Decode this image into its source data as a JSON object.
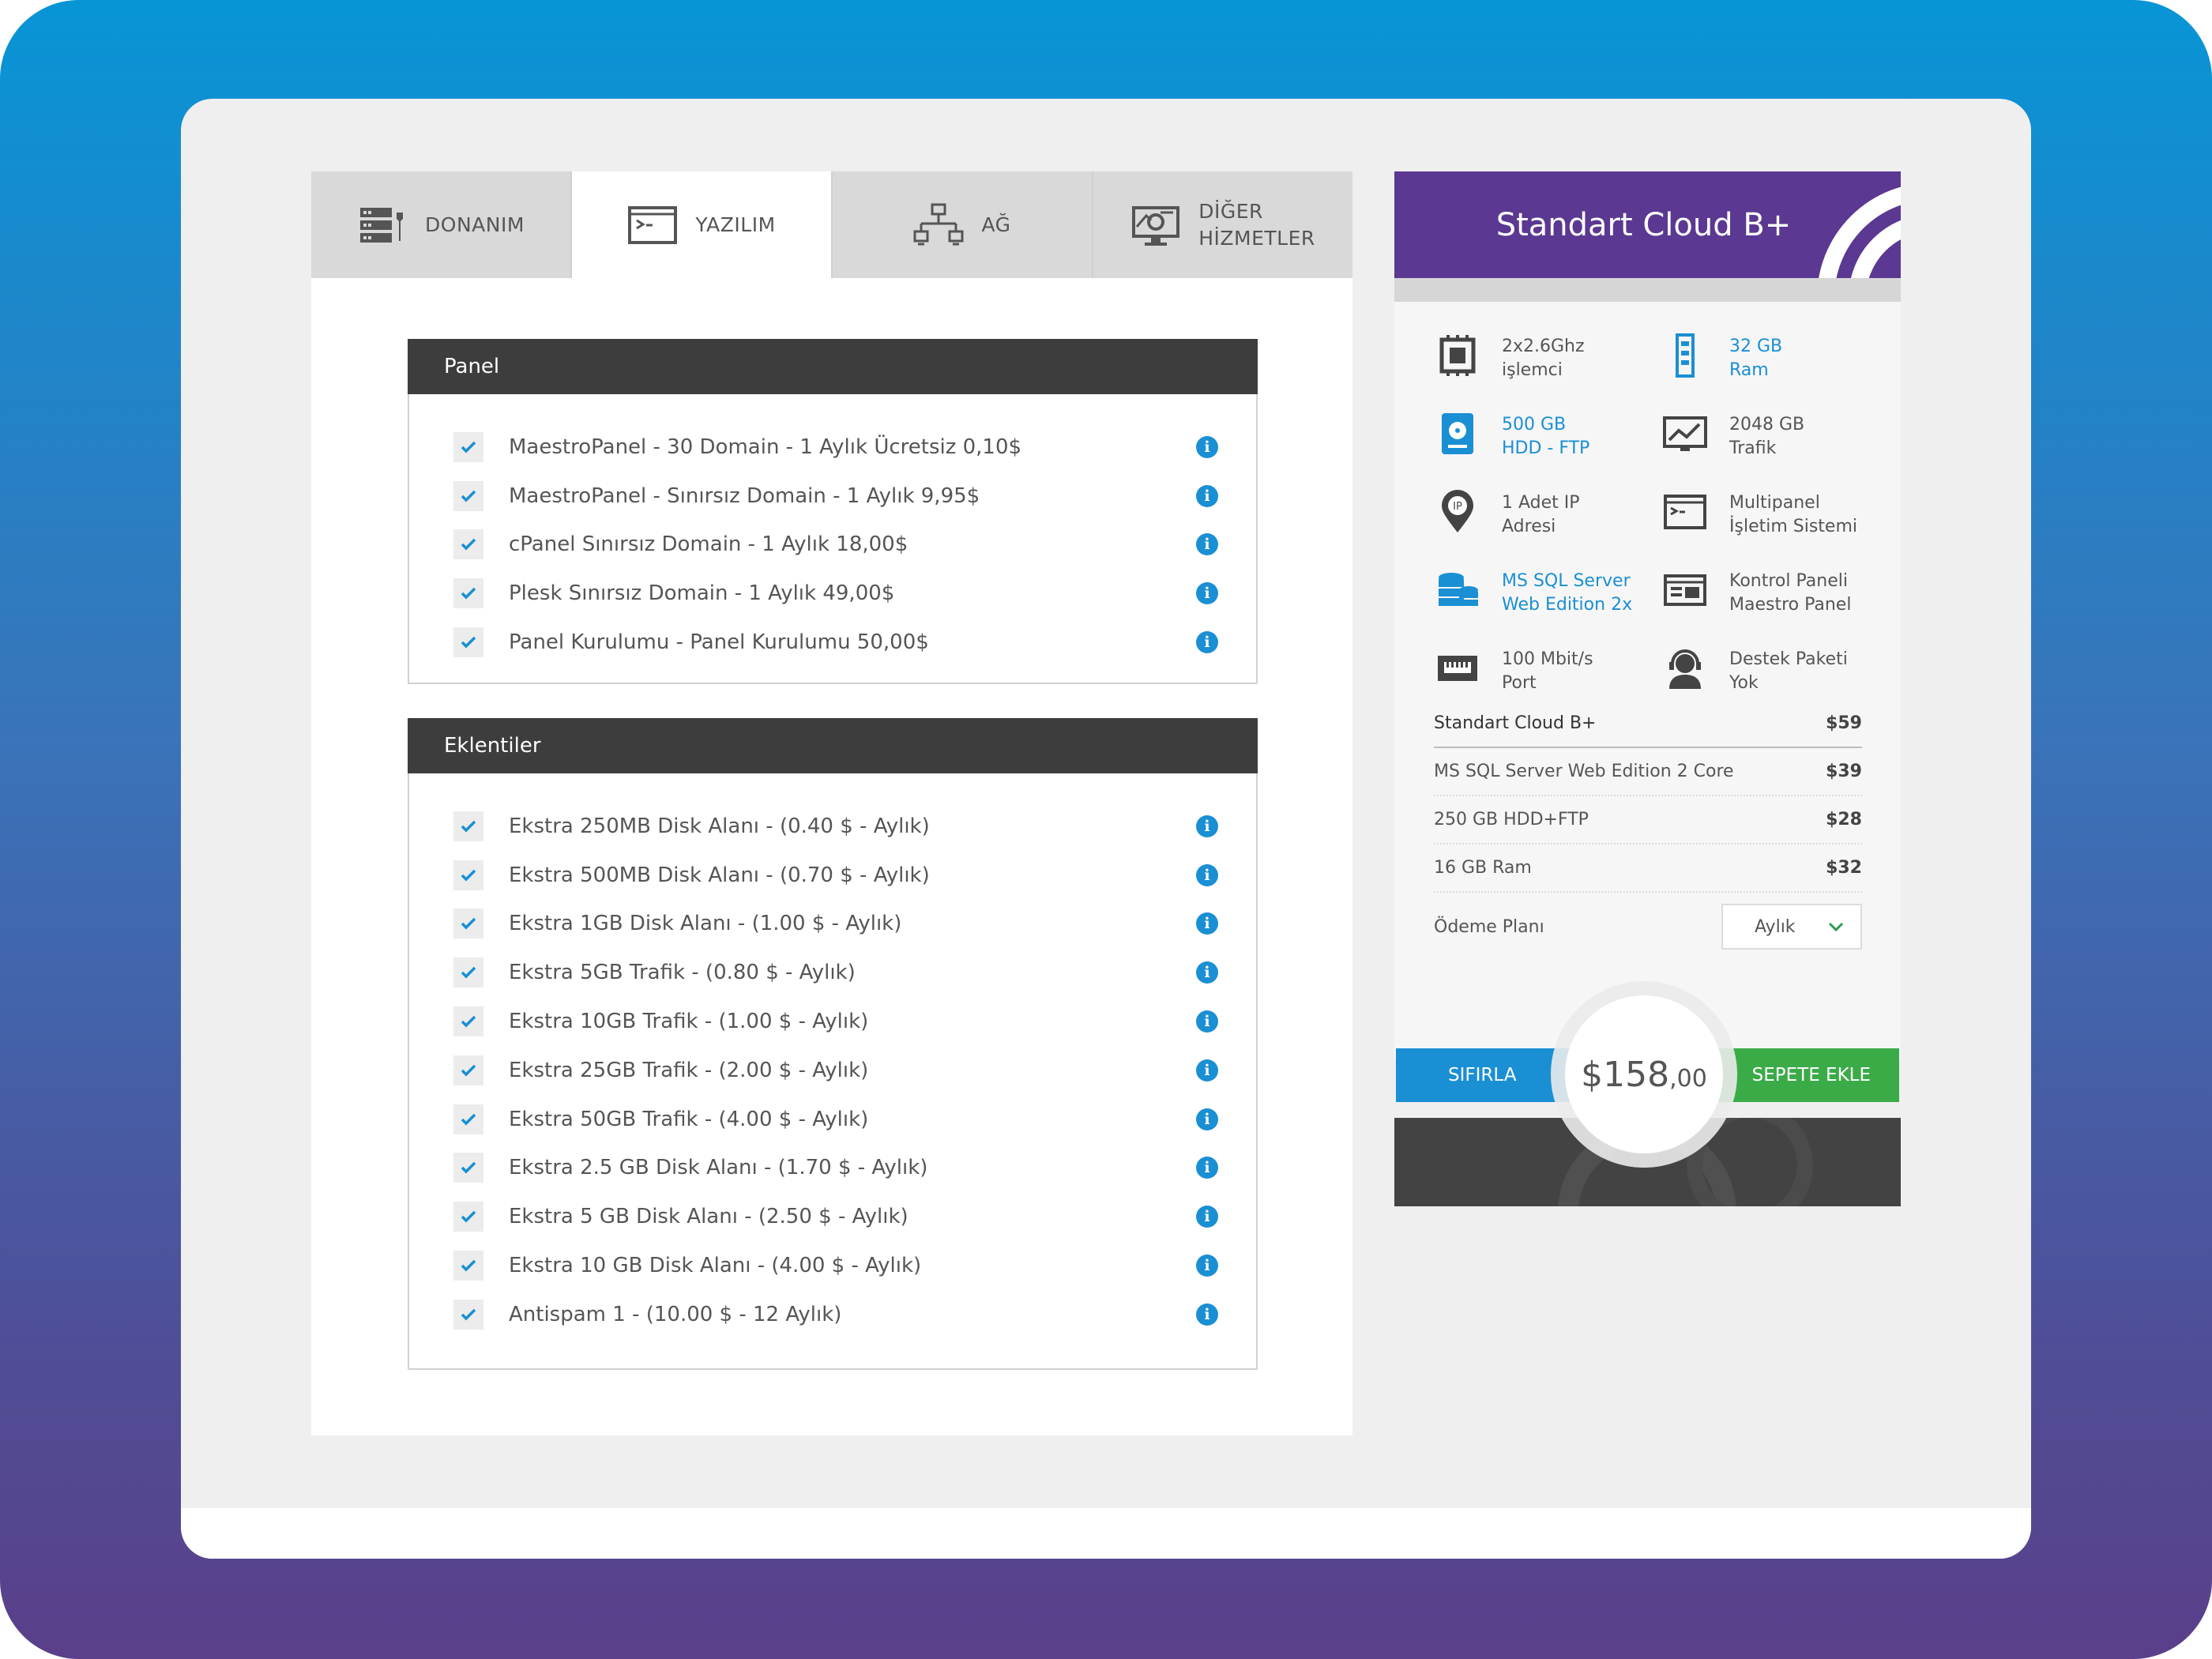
{
  "tabs": [
    {
      "label": "DONANIM",
      "icon": "server-icon",
      "active": false
    },
    {
      "label": "YAZILIM",
      "icon": "terminal-icon",
      "active": true
    },
    {
      "label": "AĞ",
      "icon": "network-icon",
      "active": false
    },
    {
      "label": "DİĞER\nHİZMETLER",
      "icon": "monitor-settings-icon",
      "active": false
    }
  ],
  "panel": {
    "title": "Panel",
    "options": [
      "MaestroPanel - 30 Domain - 1 Aylık Ücretsiz  0,10$",
      "MaestroPanel - Sınırsız Domain - 1 Aylık  9,95$",
      "cPanel Sınırsız Domain - 1 Aylık  18,00$",
      "Plesk Sınırsız Domain - 1 Aylık  49,00$",
      "Panel Kurulumu - Panel Kurulumu  50,00$"
    ]
  },
  "addons": {
    "title": "Eklentiler",
    "options": [
      "Ekstra 250MB Disk Alanı - (0.40 $ - Aylık)",
      "Ekstra 500MB Disk Alanı - (0.70 $ - Aylık)",
      "Ekstra 1GB Disk Alanı - (1.00 $ - Aylık)",
      "Ekstra 5GB Trafik - (0.80 $ - Aylık)",
      "Ekstra 10GB Trafik - (1.00 $ - Aylık)",
      "Ekstra 25GB Trafik - (2.00 $ - Aylık)",
      "Ekstra 50GB Trafik - (4.00 $ - Aylık)",
      "Ekstra 2.5 GB Disk Alanı - (1.70 $ - Aylık)",
      "Ekstra 5 GB Disk Alanı - (2.50 $ - Aylık)",
      "Ekstra 10 GB Disk Alanı - (4.00 $ - Aylık)",
      "Antispam 1 - (10.00 $ - 12 Aylık)"
    ]
  },
  "plan": {
    "title": "Standart Cloud B+",
    "specs": [
      {
        "line1": "2x2.6Ghz",
        "line2": "işlemci",
        "icon": "cpu-icon",
        "highlight": false
      },
      {
        "line1": "32 GB",
        "line2": "Ram",
        "icon": "ram-icon",
        "highlight": true
      },
      {
        "line1": "500 GB",
        "line2": "HDD - FTP",
        "icon": "hdd-icon",
        "highlight": true
      },
      {
        "line1": "2048 GB",
        "line2": "Trafik",
        "icon": "traffic-icon",
        "highlight": false
      },
      {
        "line1": "1 Adet IP",
        "line2": "Adresi",
        "icon": "ip-pin-icon",
        "highlight": false
      },
      {
        "line1": "Multipanel",
        "line2": "İşletim Sistemi",
        "icon": "terminal-icon",
        "highlight": false
      },
      {
        "line1": "MS SQL Server",
        "line2": "Web Edition 2x",
        "icon": "database-icon",
        "highlight": true
      },
      {
        "line1": "Kontrol Paneli",
        "line2": "Maestro Panel",
        "icon": "control-panel-icon",
        "highlight": false
      },
      {
        "line1": "100 Mbit/s",
        "line2": "Port",
        "icon": "ethernet-port-icon",
        "highlight": false
      },
      {
        "line1": "Destek Paketi",
        "line2": "Yok",
        "icon": "support-headset-icon",
        "highlight": false
      }
    ],
    "price_rows": [
      {
        "label": "Standart Cloud B+",
        "amount": "$59"
      },
      {
        "label": "MS SQL Server Web Edition 2 Core",
        "amount": "$39"
      },
      {
        "label": "250 GB HDD+FTP",
        "amount": "$28"
      },
      {
        "label": "16 GB Ram",
        "amount": "$32"
      }
    ],
    "payment_label": "Ödeme Planı",
    "payment_value": "Aylık",
    "reset_label": "SIFIRLA",
    "cart_label": "SEPETE EKLE",
    "total_main": "$158",
    "total_cents": ",00"
  },
  "colors": {
    "accent_blue": "#1a8fd4",
    "plan_purple": "#5b3891",
    "cart_green": "#3bab48",
    "header_dark": "#3d3d3d"
  }
}
